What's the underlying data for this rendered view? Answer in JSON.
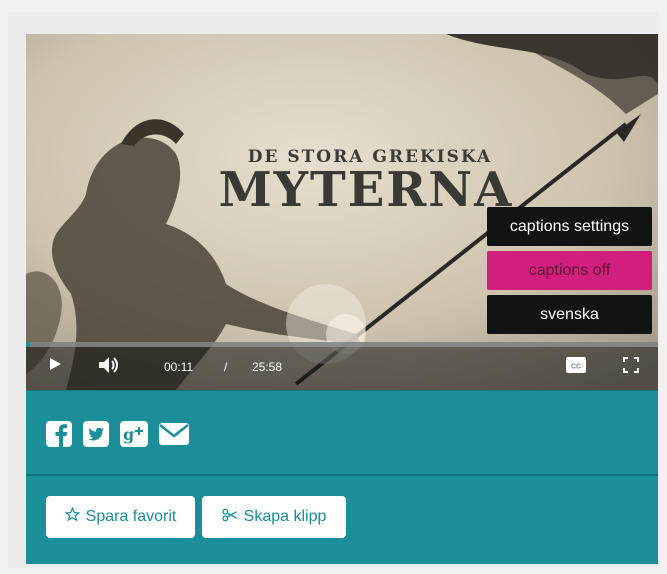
{
  "video": {
    "title_small": "DE STORA GREKISKA",
    "title_big": "MYTERNA",
    "progress_fraction": 0.007,
    "time_current": "00:11",
    "time_separator": "/",
    "time_total": "25:58"
  },
  "captions_menu": {
    "items": [
      {
        "label": "captions settings",
        "active": false
      },
      {
        "label": "captions off",
        "active": true
      },
      {
        "label": "svenska",
        "active": false
      }
    ]
  },
  "controls": {
    "icons": [
      "play-icon",
      "volume-icon",
      "cc-icon",
      "fullscreen-icon"
    ]
  },
  "share": {
    "icons": [
      "facebook-icon",
      "twitter-icon",
      "google-plus-icon",
      "email-icon"
    ]
  },
  "actions": {
    "favorite_label": "Spara favorit",
    "clip_label": "Skapa klipp"
  },
  "colors": {
    "teal": "#1a8e99",
    "caption_active": "#d21f7e",
    "menu_bg": "#111413"
  }
}
